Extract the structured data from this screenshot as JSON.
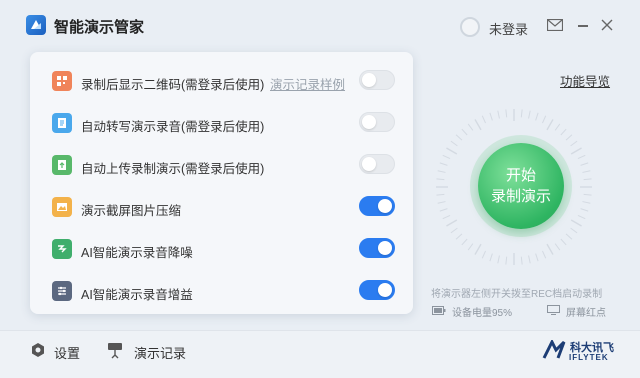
{
  "app": {
    "title": "智能演示管家"
  },
  "header": {
    "login_label": "未登录"
  },
  "options": [
    {
      "label": "录制后显示二维码(需登录后使用)",
      "link": "演示记录样例",
      "enabled": false,
      "icon": "qr-code-icon",
      "color": "#f0845a"
    },
    {
      "label": "自动转写演示录音(需登录后使用)",
      "enabled": false,
      "icon": "transcribe-icon",
      "color": "#4aa8ec"
    },
    {
      "label": "自动上传录制演示(需登录后使用)",
      "enabled": false,
      "icon": "upload-icon",
      "color": "#58b86a"
    },
    {
      "label": "演示截屏图片压缩",
      "enabled": true,
      "icon": "image-compress-icon",
      "color": "#f3b24a"
    },
    {
      "label": "AI智能演示录音降噪",
      "enabled": true,
      "icon": "noise-reduction-icon",
      "color": "#3fae6c"
    },
    {
      "label": "AI智能演示录音增益",
      "enabled": true,
      "icon": "audio-gain-icon",
      "color": "#5b6880"
    }
  ],
  "right": {
    "func_nav": "功能导览",
    "start_line1": "开始",
    "start_line2": "录制演示",
    "hint": "将演示器左侧开关拨至REC档启动录制",
    "battery": "设备电量95%",
    "screen_dot": "屏幕红点"
  },
  "footer": {
    "settings": "设置",
    "records": "演示记录",
    "brand_cn": "科大讯飞",
    "brand_en": "IFLYTEK"
  },
  "colors": {
    "accent": "#2b7cf0",
    "start_green": "#2fb562"
  }
}
